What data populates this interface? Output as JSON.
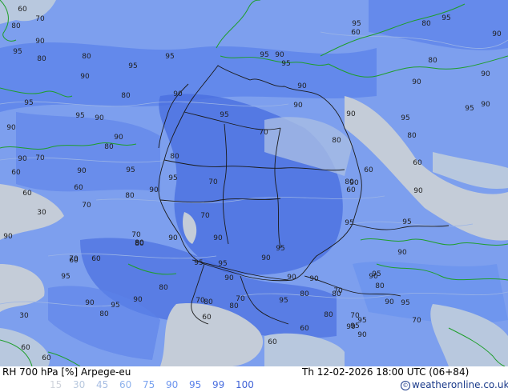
{
  "footer": {
    "title": "RH 700 hPa [%] Arpege-eu",
    "datetime": "Th 12-02-2026 18:00 UTC (06+84)",
    "credit": "weatheronline.co.uk"
  },
  "legend": [
    {
      "label": "15",
      "color": "#d0d4dc"
    },
    {
      "label": "30",
      "color": "#b8c8de"
    },
    {
      "label": "45",
      "color": "#a7bde3"
    },
    {
      "label": "60",
      "color": "#8eb2ec"
    },
    {
      "label": "75",
      "color": "#7aa3ef"
    },
    {
      "label": "90",
      "color": "#6c94ee"
    },
    {
      "label": "95",
      "color": "#5b82ea"
    },
    {
      "label": "99",
      "color": "#4a6fe0"
    },
    {
      "label": "100",
      "color": "#3f62d6"
    }
  ],
  "contour_labels": [
    "60",
    "70",
    "80",
    "90",
    "95",
    "80",
    "80",
    "95",
    "95",
    "90",
    "80",
    "90",
    "95",
    "95",
    "90",
    "95",
    "90",
    "90",
    "80",
    "70",
    "95",
    "90",
    "95",
    "90",
    "95",
    "80",
    "95",
    "90",
    "80",
    "60",
    "90",
    "90",
    "95",
    "90",
    "95",
    "90",
    "80",
    "90",
    "80",
    "60",
    "95",
    "90",
    "90",
    "60",
    "70",
    "80",
    "95",
    "70",
    "90",
    "60",
    "70",
    "80",
    "60",
    "30",
    "90",
    "90",
    "70",
    "80",
    "70",
    "60",
    "90",
    "70",
    "80",
    "95",
    "95",
    "95",
    "90",
    "80",
    "95",
    "90",
    "90",
    "30",
    "90",
    "80",
    "90",
    "80",
    "70",
    "60",
    "80",
    "95",
    "95",
    "60",
    "60",
    "60",
    "70",
    "90",
    "80",
    "60",
    "70",
    "60",
    "90",
    "90",
    "95",
    "80",
    "60",
    "90",
    "95",
    "90",
    "95",
    "80",
    "90",
    "90",
    "95",
    "95",
    "80",
    "70",
    "80",
    "70",
    "95",
    "60",
    "90"
  ]
}
